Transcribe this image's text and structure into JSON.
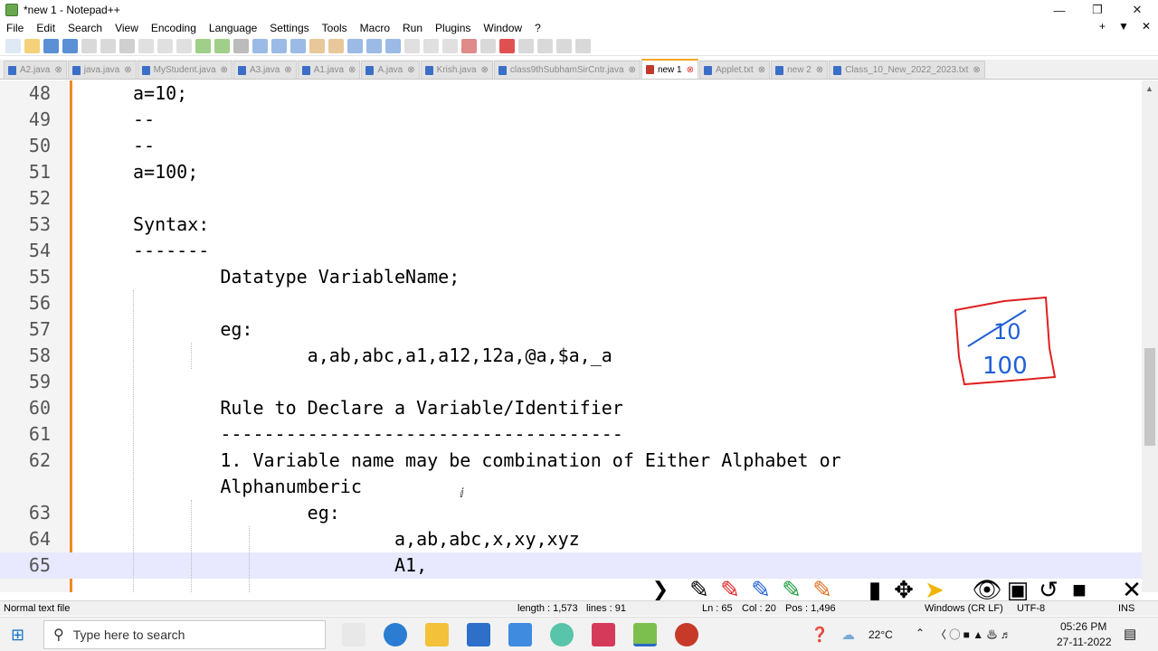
{
  "window": {
    "title": "*new 1 - Notepad++"
  },
  "menu": [
    "File",
    "Edit",
    "Search",
    "View",
    "Encoding",
    "Language",
    "Settings",
    "Tools",
    "Macro",
    "Run",
    "Plugins",
    "Window",
    "?"
  ],
  "menu_right": [
    "+",
    "▼",
    "✕"
  ],
  "tabs": [
    {
      "label": "A2.java"
    },
    {
      "label": "java.java"
    },
    {
      "label": "MyStudent.java"
    },
    {
      "label": "A3.java"
    },
    {
      "label": "A1.java"
    },
    {
      "label": "A.java"
    },
    {
      "label": "Krish.java"
    },
    {
      "label": "class9thSubhamSirCntr.java"
    },
    {
      "label": "new 1",
      "active": true
    },
    {
      "label": "Applet.txt"
    },
    {
      "label": "new 2"
    },
    {
      "label": "Class_10_New_2022_2023.txt"
    }
  ],
  "editor": {
    "lines": [
      {
        "n": "48",
        "text": "a=10;"
      },
      {
        "n": "49",
        "text": "--"
      },
      {
        "n": "50",
        "text": "--"
      },
      {
        "n": "51",
        "text": "a=100;"
      },
      {
        "n": "52",
        "text": ""
      },
      {
        "n": "53",
        "text": "Syntax:"
      },
      {
        "n": "54",
        "text": "-------"
      },
      {
        "n": "55",
        "text": "        Datatype VariableName;"
      },
      {
        "n": "56",
        "text": ""
      },
      {
        "n": "57",
        "text": "        eg:"
      },
      {
        "n": "58",
        "text": "                a,ab,abc,a1,a12,12a,@a,$a,_a"
      },
      {
        "n": "59",
        "text": ""
      },
      {
        "n": "60",
        "text": "        Rule to Declare a Variable/Identifier"
      },
      {
        "n": "61",
        "text": "        -------------------------------------"
      },
      {
        "n": "62",
        "text": "        1. Variable name may be combination of Either Alphabet or"
      },
      {
        "n": "",
        "text": "        Alphanumberic"
      },
      {
        "n": "63",
        "text": "                eg:"
      },
      {
        "n": "64",
        "text": "                        a,ab,abc,x,xy,xyz"
      },
      {
        "n": "65",
        "text": "                        A1,"
      }
    ]
  },
  "annotation": {
    "text_struck": "10",
    "text_new": "100",
    "colors": {
      "box": "#e02020",
      "ink": "#1f5fd6"
    }
  },
  "status": {
    "file_type": "Normal text file",
    "length": "length : 1,573",
    "lines": "lines : 91",
    "ln": "Ln : 65",
    "col": "Col : 20",
    "pos": "Pos : 1,496",
    "eol": "Windows (CR LF)",
    "encoding": "UTF-8",
    "mode": "INS"
  },
  "taskbar": {
    "search_placeholder": "Type here to search",
    "weather": "22°C",
    "time": "05:26 PM",
    "date": "27-11-2022"
  },
  "colors": {
    "accent": "#f5a623",
    "gutter_border": "#f08a24",
    "current_line": "#e8e8ff"
  }
}
